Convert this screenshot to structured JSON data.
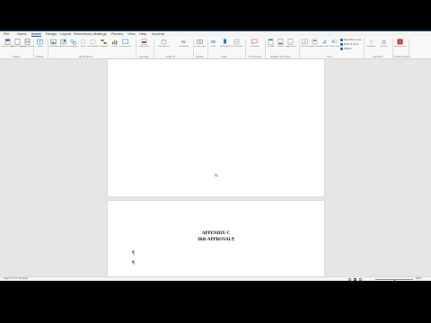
{
  "tabs": [
    {
      "label": "File"
    },
    {
      "label": "Home"
    },
    {
      "label": "Insert"
    },
    {
      "label": "Design"
    },
    {
      "label": "Layout"
    },
    {
      "label": "References"
    },
    {
      "label": "Mailings"
    },
    {
      "label": "Review"
    },
    {
      "label": "View"
    },
    {
      "label": "Help"
    },
    {
      "label": "Acrobat"
    }
  ],
  "ribbon": {
    "groups": [
      {
        "label": "Pages",
        "buttons": [
          "Cover Page",
          "Blank Page",
          "Page Break"
        ]
      },
      {
        "label": "Tables",
        "buttons": [
          "Table"
        ]
      },
      {
        "label": "Illustrations",
        "buttons": [
          "Pictures",
          "Online Pictures",
          "Shapes",
          "Icons",
          "3D Models",
          "SmartArt",
          "Chart",
          "Screenshot"
        ]
      },
      {
        "label": "Acrobat",
        "buttons": [
          "Insert PDF"
        ]
      },
      {
        "label": "Add-ins",
        "buttons": [
          "Get Add-ins",
          "Wikipedia"
        ]
      },
      {
        "label": "Media",
        "buttons": [
          "Online Video"
        ]
      },
      {
        "label": "Links",
        "buttons": [
          "Link",
          "Bookmark",
          "Cross-reference"
        ]
      },
      {
        "label": "Comments",
        "buttons": [
          "Comment"
        ]
      },
      {
        "label": "Header & Footer",
        "buttons": [
          "Header",
          "Footer",
          "Page Number"
        ]
      },
      {
        "label": "Text",
        "buttons": [
          "Text Box",
          "Quick Parts",
          "WordArt",
          "Drop Cap"
        ],
        "small": [
          "Signature Line",
          "Date & Time",
          "Object"
        ]
      },
      {
        "label": "Symbols",
        "buttons": [
          "Equation",
          "Symbol"
        ]
      },
      {
        "label": "Embed Flash",
        "buttons": [
          "Embed Flash"
        ]
      }
    ]
  },
  "document": {
    "page1_number": "76",
    "appendix_line1": "APPENDIX·C",
    "appendix_line2": "IRB·APPROVAL¶",
    "pilcrows": [
      "¶",
      "¶"
    ]
  },
  "status": {
    "left": "Page 77 of 77    111 words",
    "zoom": "100%",
    "zoom_level": 0.5
  },
  "colors": {
    "accent": "#2b579a",
    "ribbon_bg": "#f8f8f8",
    "workspace_bg": "#e6e6e6"
  }
}
